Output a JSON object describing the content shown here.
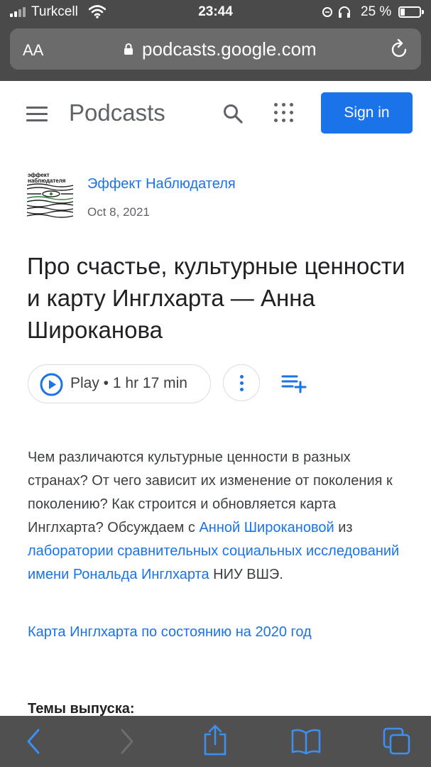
{
  "status_bar": {
    "carrier": "Turkcell",
    "time": "23:44",
    "battery": "25 %"
  },
  "browser": {
    "text_size_label": "AA",
    "url": "podcasts.google.com"
  },
  "header": {
    "brand": "Podcasts",
    "signin_label": "Sign in"
  },
  "podcast": {
    "cover_text": "эффект наблюдателя",
    "show_name": "Эффект Наблюдателя",
    "date": "Oct 8, 2021"
  },
  "episode": {
    "title": "Про счастье, культурные ценности и карту Инглхарта — Анна Широканова",
    "play_label": "Play • 1 hr 17 min"
  },
  "description": {
    "part1": "Чем различаются культурные ценности в разных странах? От чего зависит их изменение от поколения к поколению? Как строится и обновляется карта Инглхарта? Обсуждаем с ",
    "link1": "Анной Широкановой",
    "part2": " из ",
    "link2": "лаборатории сравнительных социальных исследований имени Рональда Инглхарта",
    "part3": " НИУ ВШЭ.",
    "map_link": "Карта Инглхарта по состоянию на 2020 год",
    "topics_heading": "Темы выпуска:"
  },
  "icons": {
    "header": [
      "menu-icon",
      "search-icon",
      "apps-icon"
    ],
    "toolbar": [
      "back-icon",
      "forward-icon",
      "share-icon",
      "bookmarks-icon",
      "tabs-icon"
    ]
  },
  "colors": {
    "accent": "#1a73e8",
    "status_bar": "#4a4a4a",
    "text": "#202124",
    "secondary_text": "#5f6368"
  }
}
